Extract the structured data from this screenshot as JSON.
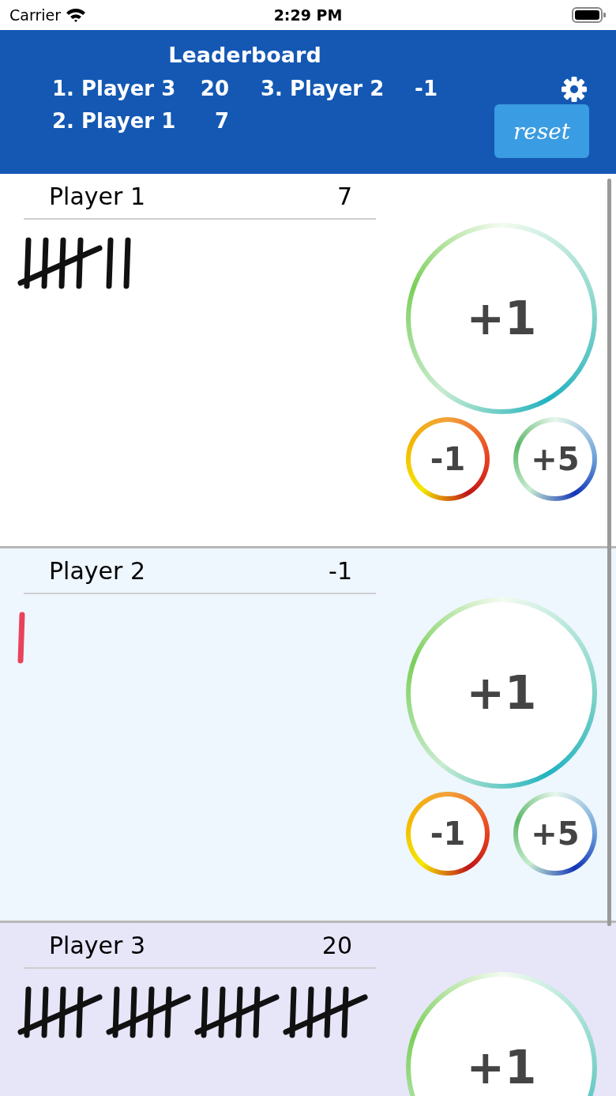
{
  "status_bar": {
    "carrier": "Carrier",
    "time": "2:29 PM"
  },
  "header": {
    "title": "Leaderboard",
    "reset_label": "reset",
    "ranking": [
      {
        "place": "1. Player 3",
        "score": "20"
      },
      {
        "place": "2. Player 1",
        "score": "7"
      },
      {
        "place": "3. Player 2",
        "score": "-1"
      }
    ]
  },
  "players": [
    {
      "name": "Player 1",
      "score": "7",
      "color": "#ffffff",
      "buttons": [
        {
          "label": "+1",
          "kind": "add"
        },
        {
          "label": "-1",
          "kind": "subtract"
        },
        {
          "label": "+5",
          "kind": "add-five"
        }
      ]
    },
    {
      "name": "Player 2",
      "score": "-1",
      "color": "#eef6fe",
      "buttons": [
        {
          "label": "+1",
          "kind": "add"
        },
        {
          "label": "-1",
          "kind": "subtract"
        },
        {
          "label": "+5",
          "kind": "add-five"
        }
      ]
    },
    {
      "name": "Player 3",
      "score": "20",
      "color": "#e7e5f8",
      "buttons": [
        {
          "label": "+1",
          "kind": "add"
        }
      ]
    }
  ]
}
